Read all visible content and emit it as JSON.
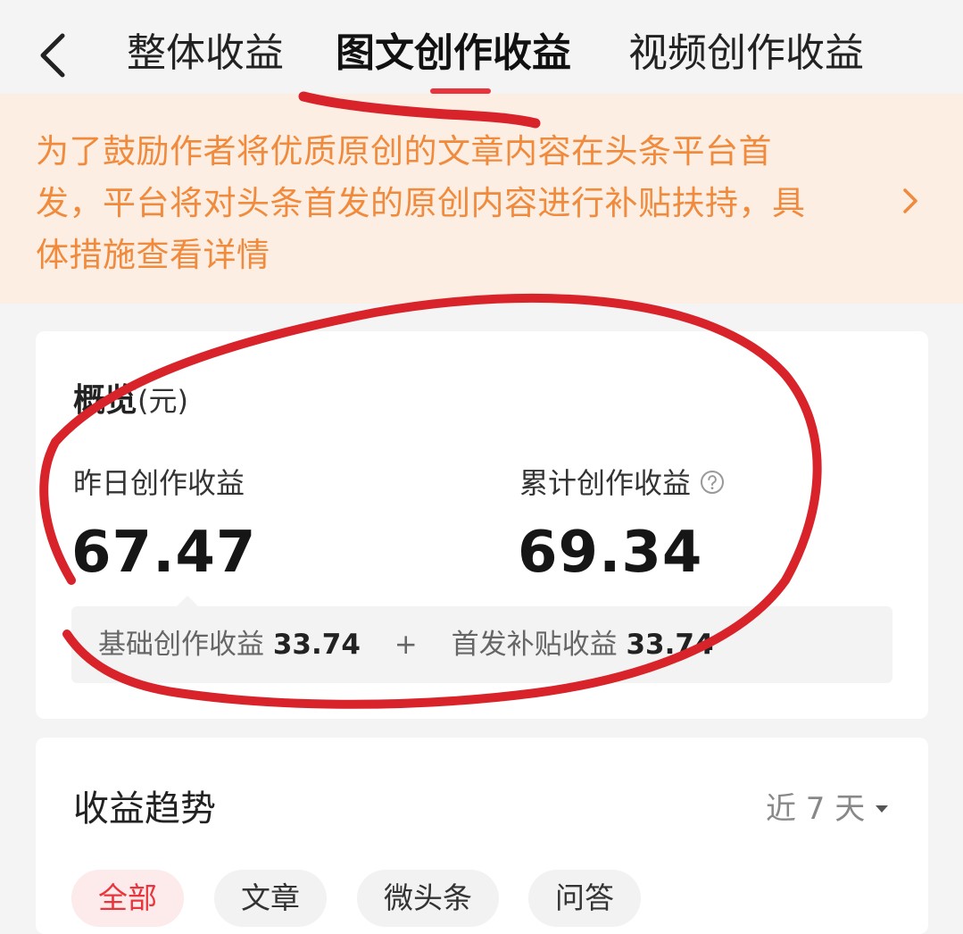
{
  "header": {
    "tabs": [
      {
        "label": "整体收益",
        "active": false
      },
      {
        "label": "图文创作收益",
        "active": true
      },
      {
        "label": "视频创作收益",
        "active": false
      }
    ]
  },
  "notice": {
    "lines": [
      "为了鼓励作者将优质原创的文章内容在头条平台首",
      "发，平台将对头条首发的原创内容进行补贴扶持，具",
      "体措施查看详情"
    ]
  },
  "overview": {
    "title": "概览",
    "unit": "(元)",
    "yesterday": {
      "label": "昨日创作收益",
      "value": "67.47"
    },
    "total": {
      "label": "累计创作收益",
      "value": "69.34"
    },
    "breakdown": {
      "base_label": "基础创作收益",
      "base_value": "33.74",
      "plus": "+",
      "subsidy_label": "首发补贴收益",
      "subsidy_value": "33.74"
    }
  },
  "trend": {
    "title": "收益趋势",
    "range": "近 7 天",
    "chips": [
      {
        "label": "全部",
        "active": true
      },
      {
        "label": "文章",
        "active": false
      },
      {
        "label": "微头条",
        "active": false
      },
      {
        "label": "问答",
        "active": false
      }
    ]
  },
  "colors": {
    "accent": "#e8343c",
    "notice_text": "#f08a3c",
    "notice_bg": "#fdeee3",
    "annotation": "#d9232b"
  },
  "icons": {
    "back": "chevron-left-icon",
    "notice_arrow": "chevron-right-icon",
    "help": "question-circle-icon",
    "range_caret": "caret-down-icon"
  }
}
